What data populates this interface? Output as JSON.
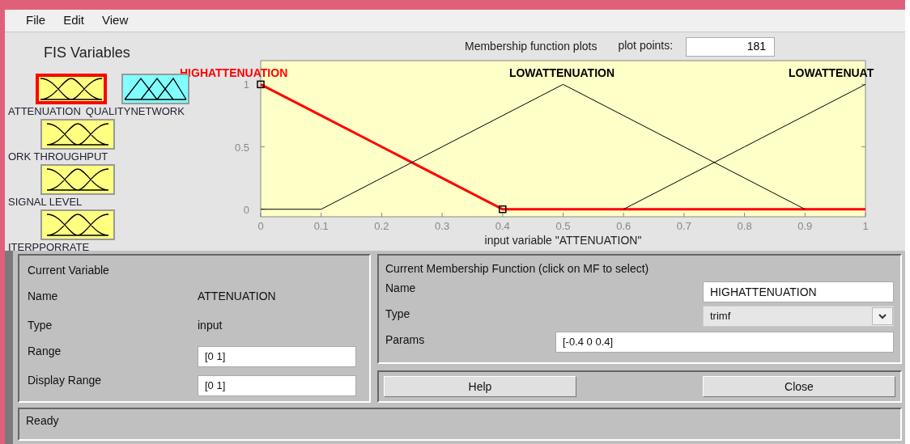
{
  "menu": [
    "File",
    "Edit",
    "View"
  ],
  "fis_title": "FIS Variables",
  "variables": [
    {
      "name": "ATTENUATION",
      "kind": "input",
      "selected": true
    },
    {
      "name": "QUALITYNETWORK",
      "kind": "output",
      "selected": false
    },
    {
      "name": "ORK THROUGHPUT",
      "kind": "input",
      "selected": false
    },
    {
      "name": "SIGNAL LEVEL",
      "kind": "input",
      "selected": false
    },
    {
      "name": "ITERPPORRATE",
      "kind": "input",
      "selected": false
    }
  ],
  "plot_title": "Membership function plots",
  "plot_points": {
    "label": "plot points:",
    "value": "181"
  },
  "membership_functions": [
    {
      "selected": true
    },
    {
      "selected": false
    },
    {
      "selected": false
    }
  ],
  "chart_data": {
    "type": "line",
    "xlabel": "input variable \"ATTENUATION\"",
    "x": [
      0,
      0.1,
      0.2,
      0.3,
      0.4,
      0.5,
      0.6,
      0.7,
      0.8,
      0.9,
      1
    ],
    "xlim": [
      0,
      1
    ],
    "ylim": [
      -0.06,
      1.19
    ],
    "xticks": [
      0,
      0.1,
      0.2,
      0.3,
      0.4,
      0.5,
      0.6,
      0.7,
      0.8,
      0.9,
      1
    ],
    "yticks": [
      0,
      0.5,
      1
    ],
    "series": [
      {
        "name": "HIGHATTENUATION",
        "color": "#ff0000",
        "values": [
          1,
          0.75,
          0.5,
          0.25,
          0,
          0,
          0,
          0,
          0,
          0,
          0
        ]
      },
      {
        "name": "LOWATTENUATION",
        "color": "#000000",
        "values": [
          0,
          0,
          0.25,
          0.5,
          0.75,
          1,
          0.75,
          0.5,
          0.25,
          0,
          null
        ]
      },
      {
        "name": "LOWATTENUAT",
        "color": "#000000",
        "values": [
          null,
          null,
          null,
          null,
          null,
          null,
          0,
          0.25,
          0.5,
          0.75,
          1
        ]
      }
    ]
  },
  "current_variable": {
    "title": "Current Variable",
    "name_label": "Name",
    "name": "ATTENUATION",
    "type_label": "Type",
    "type": "input",
    "range_label": "Range",
    "range": "[0 1]",
    "display_range_label": "Display Range",
    "display_range": "[0 1]"
  },
  "current_mf": {
    "title": "Current Membership Function (click on MF to select)",
    "name_label": "Name",
    "name": "HIGHATTENUATION",
    "type_label": "Type",
    "type": "trimf",
    "params_label": "Params",
    "params": "[-0.4 0 0.4]"
  },
  "buttons": [
    "Help",
    "Close"
  ],
  "status": "Ready"
}
